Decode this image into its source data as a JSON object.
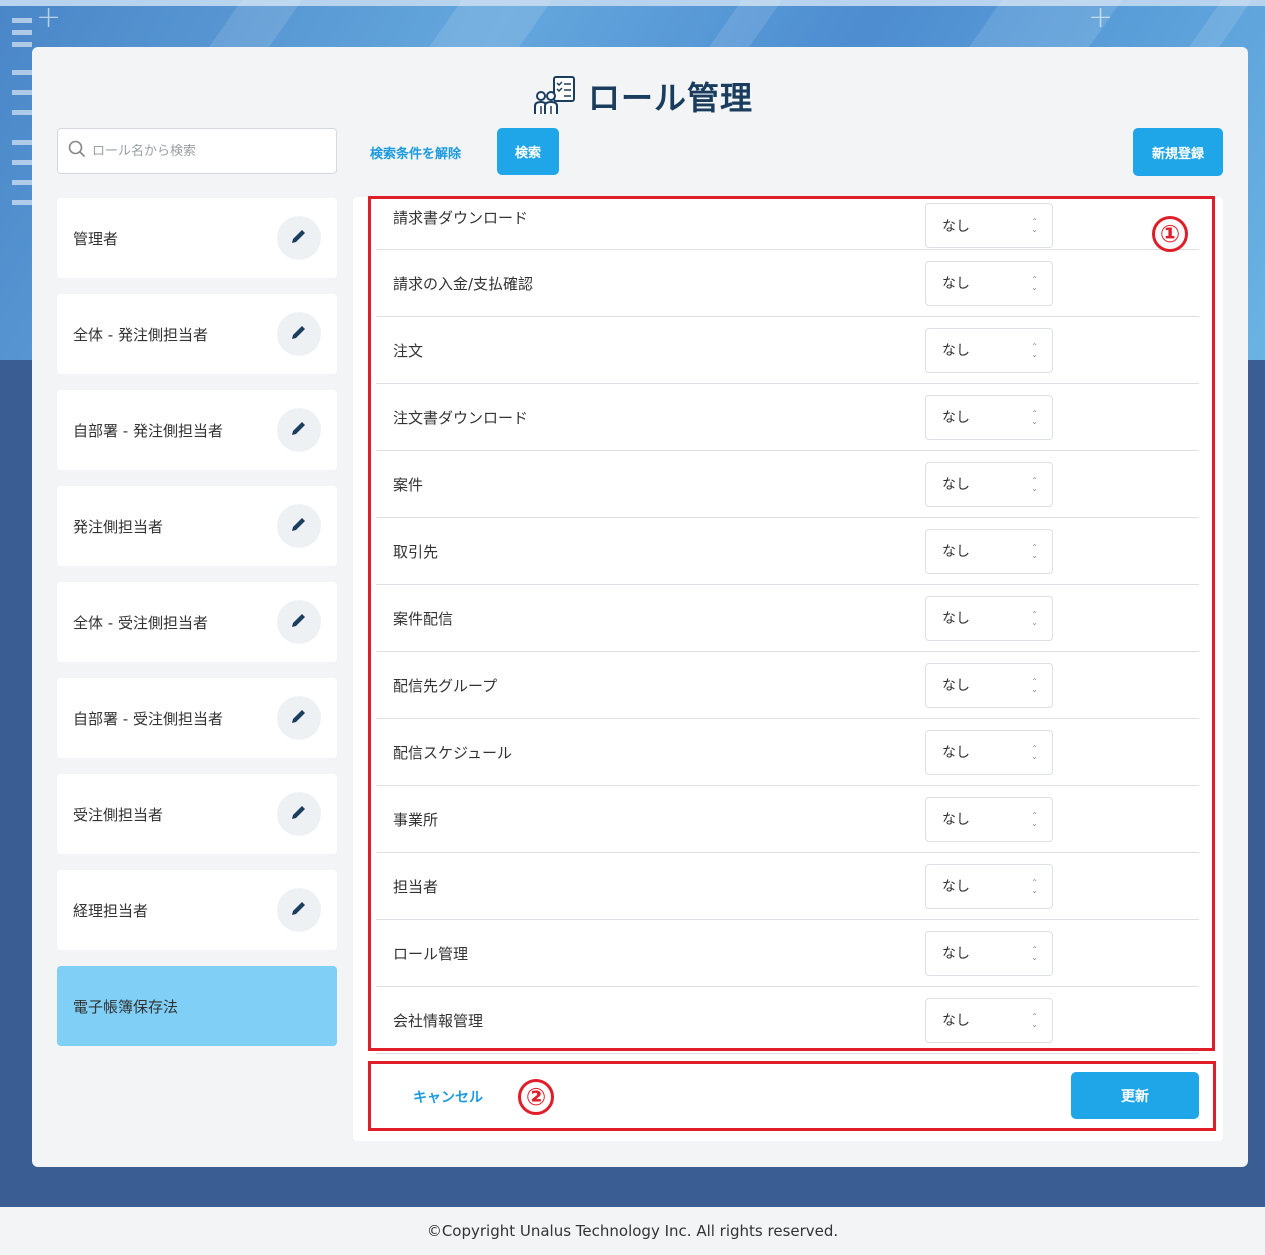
{
  "page": {
    "title": "ロール管理",
    "footer": "©Copyright Unalus Technology Inc. All rights reserved."
  },
  "search": {
    "placeholder": "ロール名から検索",
    "clear_label": "検索条件を解除",
    "search_label": "検索",
    "new_label": "新規登録"
  },
  "roles": [
    {
      "label": "管理者"
    },
    {
      "label": "全体 - 発注側担当者"
    },
    {
      "label": "自部署 - 発注側担当者"
    },
    {
      "label": "発注側担当者"
    },
    {
      "label": "全体 - 受注側担当者"
    },
    {
      "label": "自部署 - 受注側担当者"
    },
    {
      "label": "受注側担当者"
    },
    {
      "label": "経理担当者"
    },
    {
      "label": "電子帳簿保存法"
    }
  ],
  "permissions": [
    {
      "label": "請求書ダウンロード",
      "value": "なし"
    },
    {
      "label": "請求の入金/支払確認",
      "value": "なし"
    },
    {
      "label": "注文",
      "value": "なし"
    },
    {
      "label": "注文書ダウンロード",
      "value": "なし"
    },
    {
      "label": "案件",
      "value": "なし"
    },
    {
      "label": "取引先",
      "value": "なし"
    },
    {
      "label": "案件配信",
      "value": "なし"
    },
    {
      "label": "配信先グループ",
      "value": "なし"
    },
    {
      "label": "配信スケジュール",
      "value": "なし"
    },
    {
      "label": "事業所",
      "value": "なし"
    },
    {
      "label": "担当者",
      "value": "なし"
    },
    {
      "label": "ロール管理",
      "value": "なし"
    },
    {
      "label": "会社情報管理",
      "value": "なし"
    }
  ],
  "actions": {
    "cancel_label": "キャンセル",
    "update_label": "更新"
  },
  "annotations": {
    "one": "①",
    "two": "②",
    "color": "#e01e2a"
  },
  "colors": {
    "accent": "#1fa6e8",
    "active_role": "#7fcff7",
    "title": "#1a3d5e"
  }
}
